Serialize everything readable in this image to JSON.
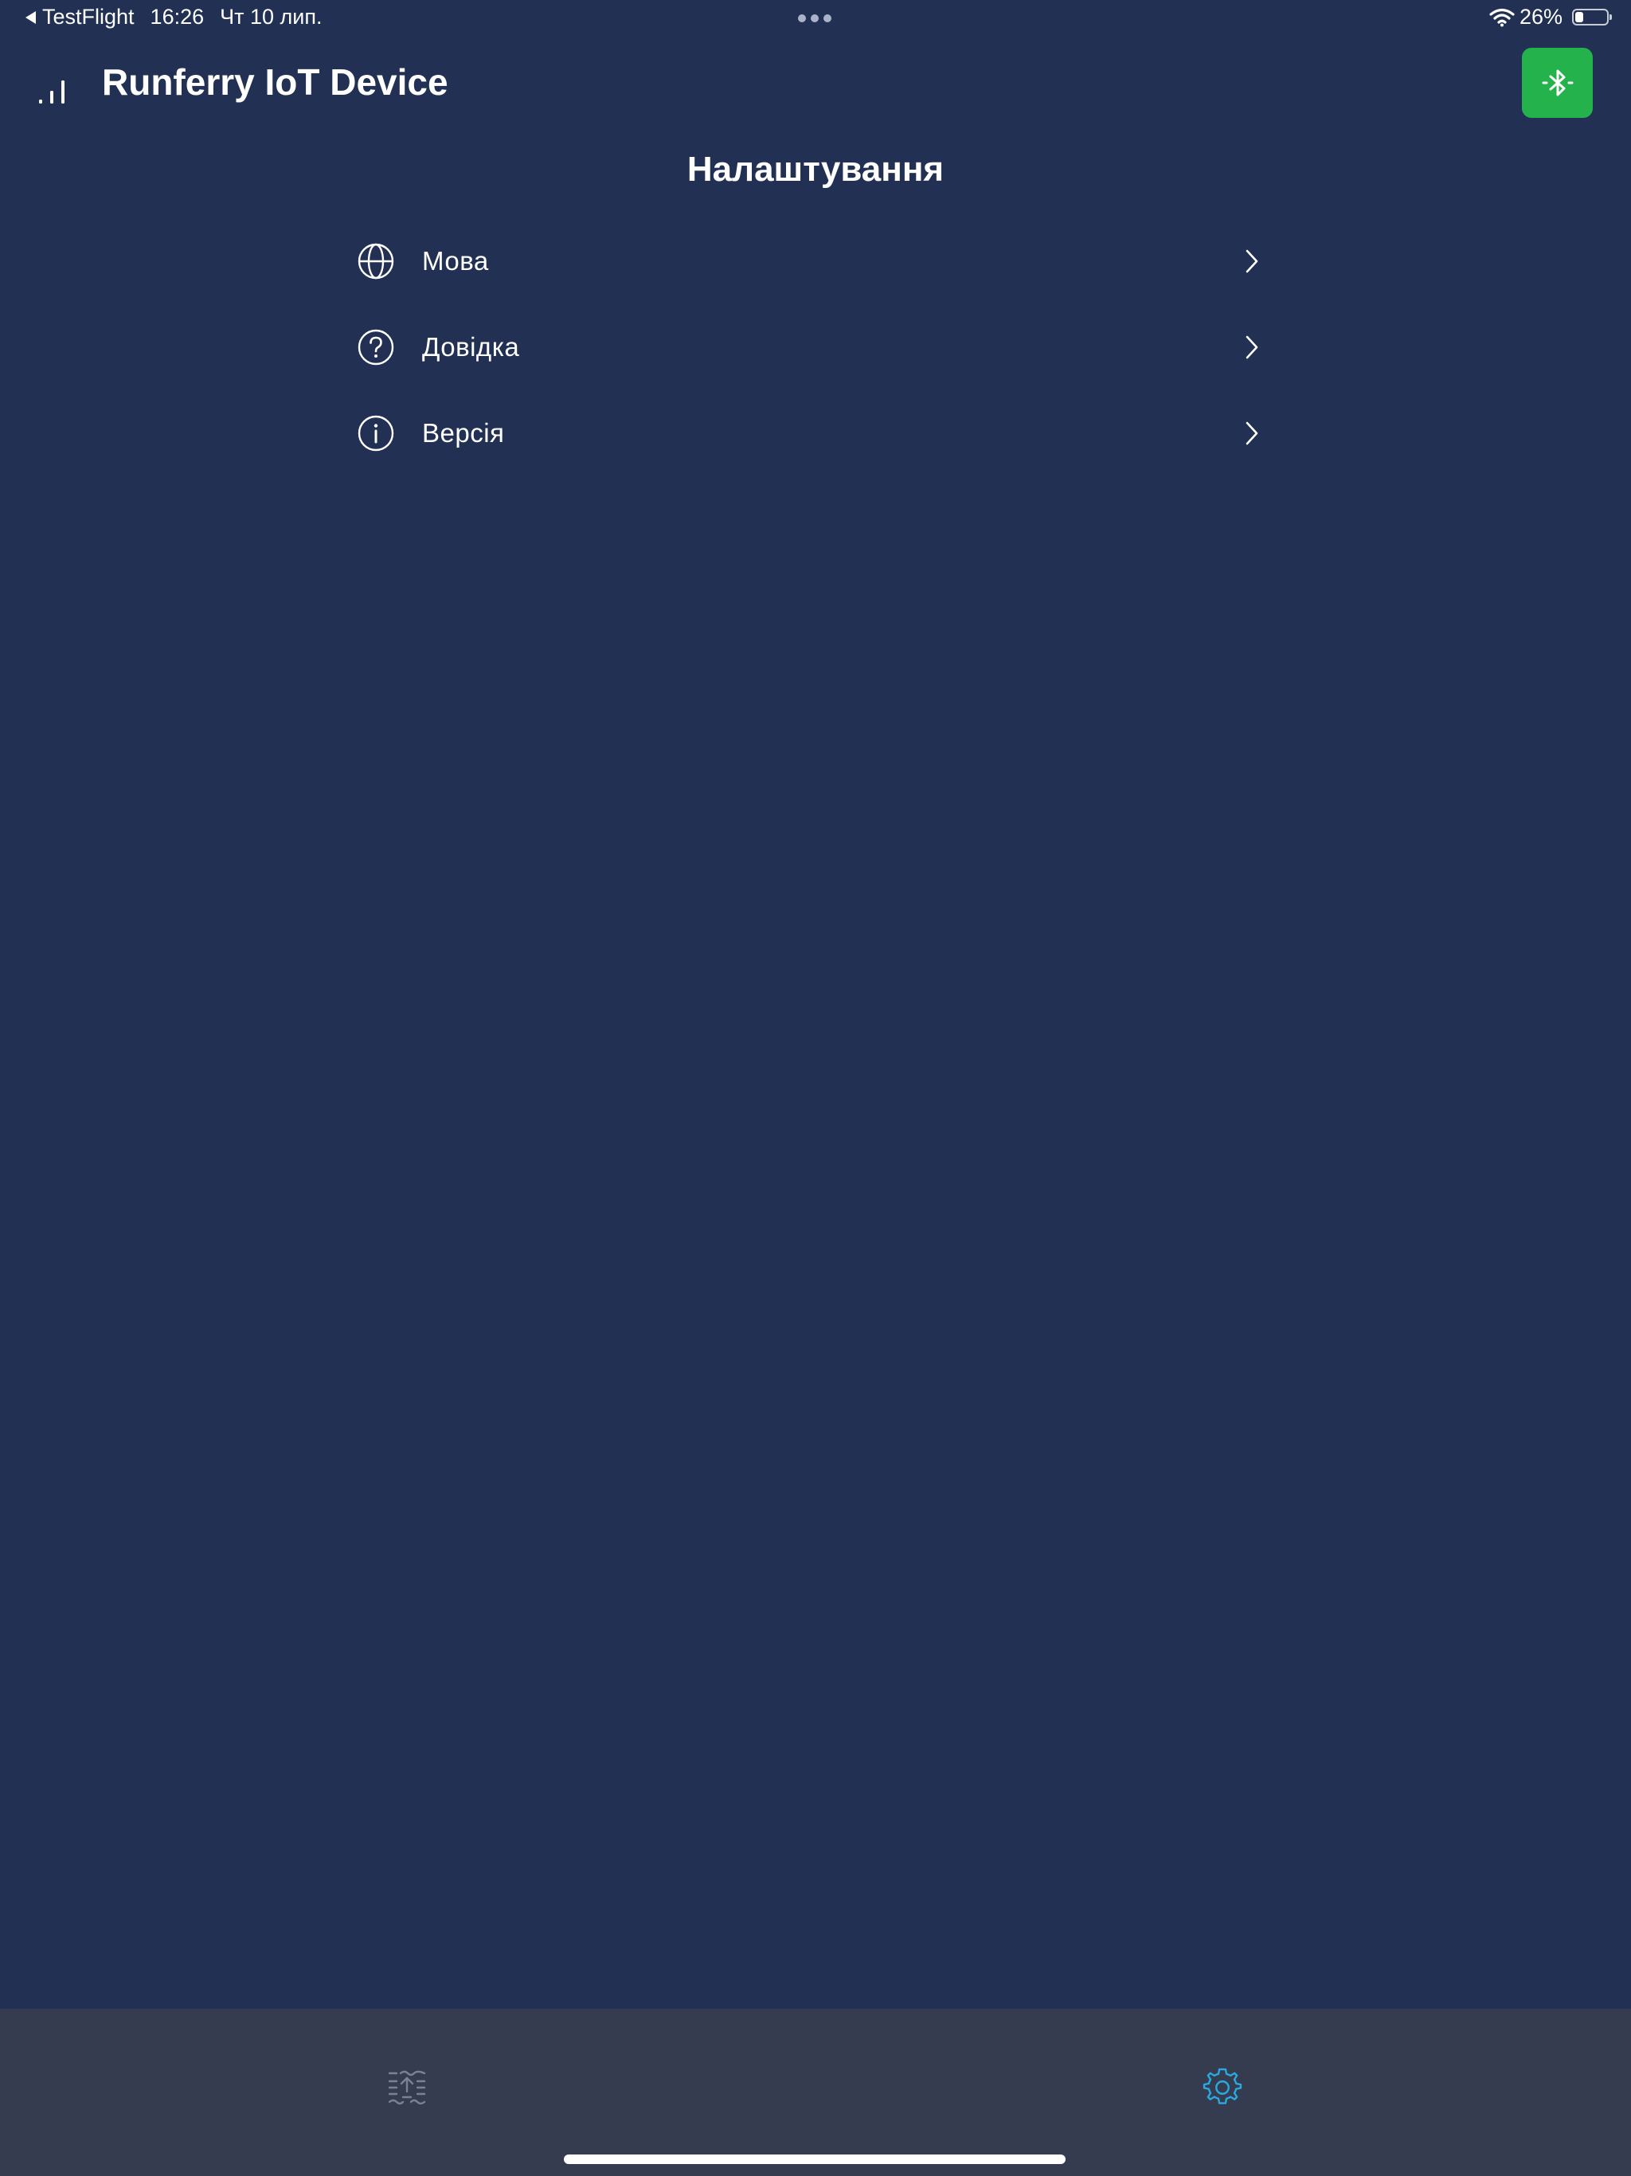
{
  "status_bar": {
    "back_app": "TestFlight",
    "time": "16:26",
    "date": "Чт 10 лип.",
    "battery_percent": "26%",
    "battery_level": 0.26
  },
  "header": {
    "app_title": "Runferry IoT Device",
    "bluetooth_button_color": "#24b24d"
  },
  "page": {
    "title": "Налаштування"
  },
  "settings": {
    "items": [
      {
        "label": "Мова",
        "icon": "globe-icon"
      },
      {
        "label": "Довідка",
        "icon": "question-circle-icon"
      },
      {
        "label": "Версія",
        "icon": "info-circle-icon"
      }
    ]
  },
  "tab_bar": {
    "tabs": [
      {
        "icon": "data-transfer-icon",
        "active": false
      },
      {
        "icon": "gear-icon",
        "active": true
      }
    ],
    "active_color": "#29a9e0",
    "inactive_color": "#7b8193"
  },
  "colors": {
    "background": "#223153",
    "tab_bar": "#363c4f"
  }
}
